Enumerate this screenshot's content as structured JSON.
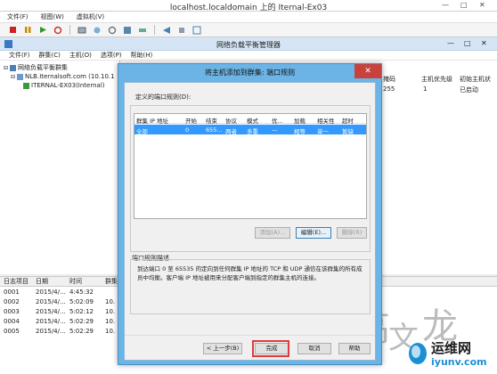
{
  "vm": {
    "title": "localhost.localdomain 上的 Iternal-Ex03",
    "menu": [
      "文件(F)",
      "视图(W)",
      "虚拟机(V)"
    ]
  },
  "nlb": {
    "title": "网络负载平衡管理器",
    "menu": [
      "文件(F)",
      "群集(C)",
      "主机(O)",
      "选项(P)",
      "帮助(H)"
    ],
    "tree": {
      "root": "网络负载平衡群集",
      "cluster": "NLB.Iternalsoft.com (10.10.1",
      "host": "ITERNAL-EX03(Internal)"
    },
    "right_headers": [
      "掩码",
      "主机优先级",
      "初始主机状"
    ],
    "right_row": [
      "255",
      "1",
      "已启动"
    ],
    "log": {
      "headers": [
        "日志项目",
        "日期",
        "时间",
        "群集"
      ],
      "rows": [
        [
          "0001",
          "2015/4/...",
          "4:45:32",
          ""
        ],
        [
          "0002",
          "2015/4/...",
          "5:02:09",
          "10."
        ],
        [
          "0003",
          "2015/4/...",
          "5:02:12",
          "10."
        ],
        [
          "0004",
          "2015/4/...",
          "5:02:29",
          "10."
        ],
        [
          "0005",
          "2015/4/...",
          "5:02:29",
          "10."
        ]
      ]
    }
  },
  "dialog": {
    "title": "将主机添加到群集: 端口规则",
    "ports_label": "定义的端口规则(D):",
    "columns": [
      "群集 IP 地址",
      "开始",
      "结束",
      "协议",
      "模式",
      "优...",
      "加载",
      "相关性",
      "超时"
    ],
    "rule": [
      "全部",
      "0",
      "655...",
      "两者",
      "多重",
      "—",
      "相等",
      "单一",
      "暂缺"
    ],
    "buttons": {
      "add": "添加(A)...",
      "edit": "编辑(E)...",
      "delete": "删除(R)"
    },
    "desc_label": "端口规则描述",
    "description": "到达端口 0 至 65535 的定向到任何群集 IP 地址的 TCP 和 UDP 通信在该群集的所有成员中均衡。客户端 IP 地址被用来分配客户端到指定的群集主机的连接。",
    "footer": {
      "back": "< 上一步(B)",
      "finish": "完成",
      "cancel": "取消",
      "help": "帮助"
    }
  },
  "watermark": {
    "chars": [
      "高",
      "文",
      "龙"
    ]
  },
  "logo": {
    "text_cn": "运维网",
    "text_en": "iyunv.com"
  },
  "colors": {
    "dialog_frame": "#6bb4e5",
    "selected_row": "#3399ff",
    "highlight": "#e23b3b"
  }
}
